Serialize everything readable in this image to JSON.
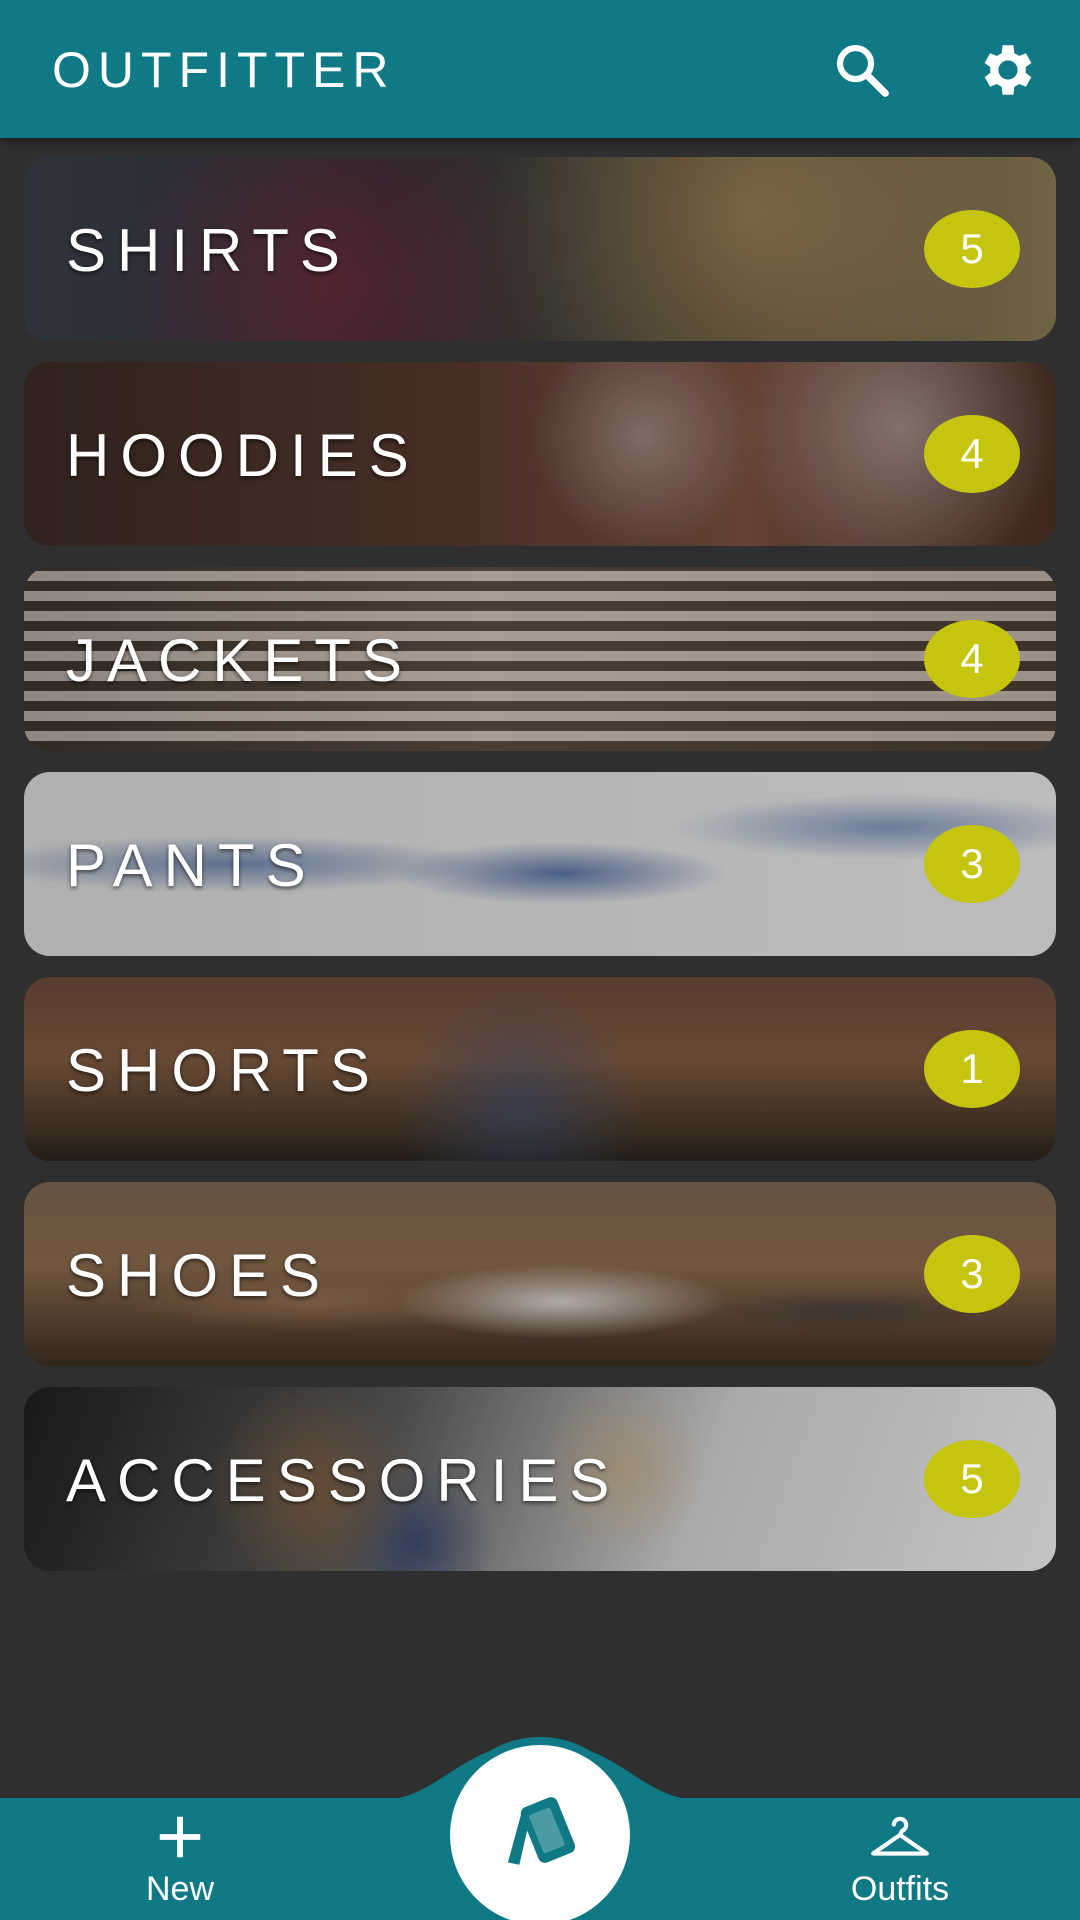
{
  "app": {
    "title": "OUTFITTER"
  },
  "toolbar": {
    "search_icon": "search-icon",
    "settings_icon": "gear-icon"
  },
  "categories": [
    {
      "label": "SHIRTS",
      "count": "5"
    },
    {
      "label": "HOODIES",
      "count": "4"
    },
    {
      "label": "JACKETS",
      "count": "4"
    },
    {
      "label": "PANTS",
      "count": "3"
    },
    {
      "label": "SHORTS",
      "count": "1"
    },
    {
      "label": "SHOES",
      "count": "3"
    },
    {
      "label": "ACCESSORIES",
      "count": "5"
    }
  ],
  "bottom_nav": {
    "new_label": "New",
    "outfits_label": "Outfits",
    "new_icon": "plus-icon",
    "outfits_icon": "hanger-icon",
    "center_icon": "cards-icon"
  },
  "colors": {
    "primary": "#0f7a86",
    "badge": "#c5c40f",
    "background": "#2f2f2f"
  }
}
